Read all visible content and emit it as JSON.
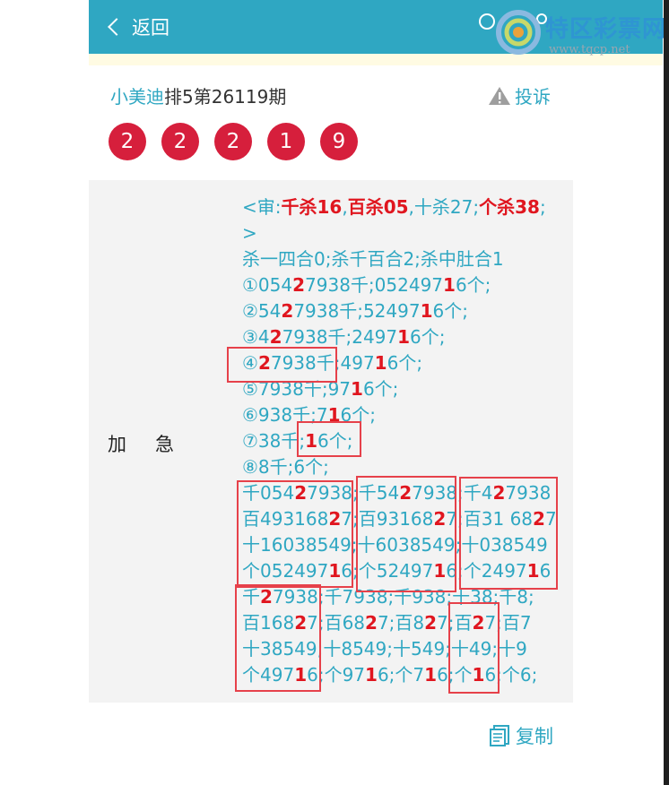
{
  "header": {
    "back_label": "返回"
  },
  "watermark": {
    "name": "特区彩票网",
    "url": "www.tqcp.net"
  },
  "post": {
    "author": "小美迪",
    "issue": "排5第26119期",
    "report_label": "投诉",
    "balls": [
      "2",
      "2",
      "2",
      "1",
      "9"
    ],
    "row_label": "加急"
  },
  "content_lines": [
    [
      [
        "<审:",
        ""
      ],
      [
        "千杀16",
        "r"
      ],
      [
        ",",
        ""
      ],
      [
        "百杀05",
        "r"
      ],
      [
        ",十杀27;",
        ""
      ],
      [
        "个杀38",
        "r"
      ],
      [
        ";",
        ""
      ]
    ],
    [
      [
        ">",
        ""
      ]
    ],
    [
      [
        "杀一四合0;杀千百合2;杀中肚合1",
        ""
      ]
    ],
    [
      [
        "①054",
        ""
      ],
      [
        "2",
        "r"
      ],
      [
        "7938千;052497",
        ""
      ],
      [
        "1",
        "r"
      ],
      [
        "6个;",
        ""
      ]
    ],
    [
      [
        "②54",
        ""
      ],
      [
        "2",
        "r"
      ],
      [
        "7938千;52497",
        ""
      ],
      [
        "1",
        "r"
      ],
      [
        "6个;",
        ""
      ]
    ],
    [
      [
        "③4",
        ""
      ],
      [
        "2",
        "r"
      ],
      [
        "7938千;2497",
        ""
      ],
      [
        "1",
        "r"
      ],
      [
        "6个;",
        ""
      ]
    ],
    [
      [
        "④",
        ""
      ],
      [
        "2",
        "r"
      ],
      [
        "7938千;497",
        ""
      ],
      [
        "1",
        "r"
      ],
      [
        "6个;",
        ""
      ]
    ],
    [
      [
        "⑤7938千;97",
        ""
      ],
      [
        "1",
        "r"
      ],
      [
        "6个;",
        ""
      ]
    ],
    [
      [
        "⑥938千;7",
        ""
      ],
      [
        "1",
        "r"
      ],
      [
        "6个;",
        ""
      ]
    ],
    [
      [
        "⑦38千;",
        ""
      ],
      [
        "1",
        "r"
      ],
      [
        "6个;",
        ""
      ]
    ],
    [
      [
        "⑧8千;6个;",
        ""
      ]
    ],
    [
      [
        "千054",
        ""
      ],
      [
        "2",
        "r"
      ],
      [
        "7938;千54",
        ""
      ],
      [
        "2",
        "r"
      ],
      [
        "7938;千4",
        ""
      ],
      [
        "2",
        "r"
      ],
      [
        "7938",
        ""
      ]
    ],
    [
      [
        "百4931",
        ""
      ],
      [
        "68",
        ""
      ],
      [
        "2",
        "r"
      ],
      [
        "7;百93168",
        ""
      ],
      [
        "2",
        "r"
      ],
      [
        "7;百31 68",
        ""
      ],
      [
        "2",
        "r"
      ],
      [
        "7",
        ""
      ]
    ],
    [
      [
        "十16038549;十6038549;十038549",
        ""
      ]
    ],
    [
      [
        "个052497",
        ""
      ],
      [
        "1",
        "r"
      ],
      [
        "6;个52497",
        ""
      ],
      [
        "1",
        "r"
      ],
      [
        "6;个2497",
        ""
      ],
      [
        "1",
        "r"
      ],
      [
        "6",
        ""
      ]
    ],
    [
      [
        "千",
        ""
      ],
      [
        "2",
        "r"
      ],
      [
        "7938;千7938;千938;十38;千8;",
        ""
      ]
    ],
    [
      [
        "百168",
        ""
      ],
      [
        "2",
        "r"
      ],
      [
        "7;百68",
        ""
      ],
      [
        "2",
        "r"
      ],
      [
        "7;百8",
        ""
      ],
      [
        "2",
        "r"
      ],
      [
        "7;百",
        ""
      ],
      [
        "2",
        "r"
      ],
      [
        "7;百7",
        ""
      ]
    ],
    [
      [
        "十38549;十8549;十549;十49;十9",
        ""
      ]
    ],
    [
      [
        "个497",
        ""
      ],
      [
        "1",
        "r"
      ],
      [
        "6;个97",
        ""
      ],
      [
        "1",
        "r"
      ],
      [
        "6;个7",
        ""
      ],
      [
        "1",
        "r"
      ],
      [
        "6;个",
        ""
      ],
      [
        "1",
        "r"
      ],
      [
        "6;个6;",
        ""
      ]
    ]
  ],
  "copy_label": "复制",
  "colors": {
    "accent": "#2fa7c2",
    "ball": "#d61f3c",
    "highlight": "#e0161f",
    "box": "#e6414a"
  }
}
